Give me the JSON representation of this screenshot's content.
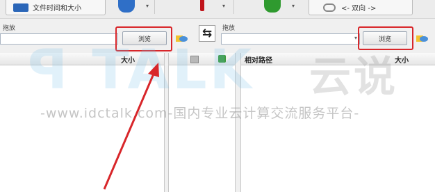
{
  "toolbar": {
    "compare_button_label": "文件时间和大小",
    "sync_direction_label": "<- 双向 ->"
  },
  "left_panel": {
    "folder_label": "拖放",
    "browse_label": "浏览",
    "column_size": "大小"
  },
  "right_panel": {
    "folder_label": "拖放",
    "browse_label": "浏览",
    "column_relative_path": "相对路径",
    "column_size": "大小"
  },
  "watermark": {
    "brand": "TALK 云说",
    "url": "-www.idctalk.com-国内专业云计算交流服务平台-"
  },
  "colors": {
    "highlight_red": "#d8262a",
    "gear_blue": "#2f6fc7",
    "gear_green": "#2f9a2f"
  }
}
